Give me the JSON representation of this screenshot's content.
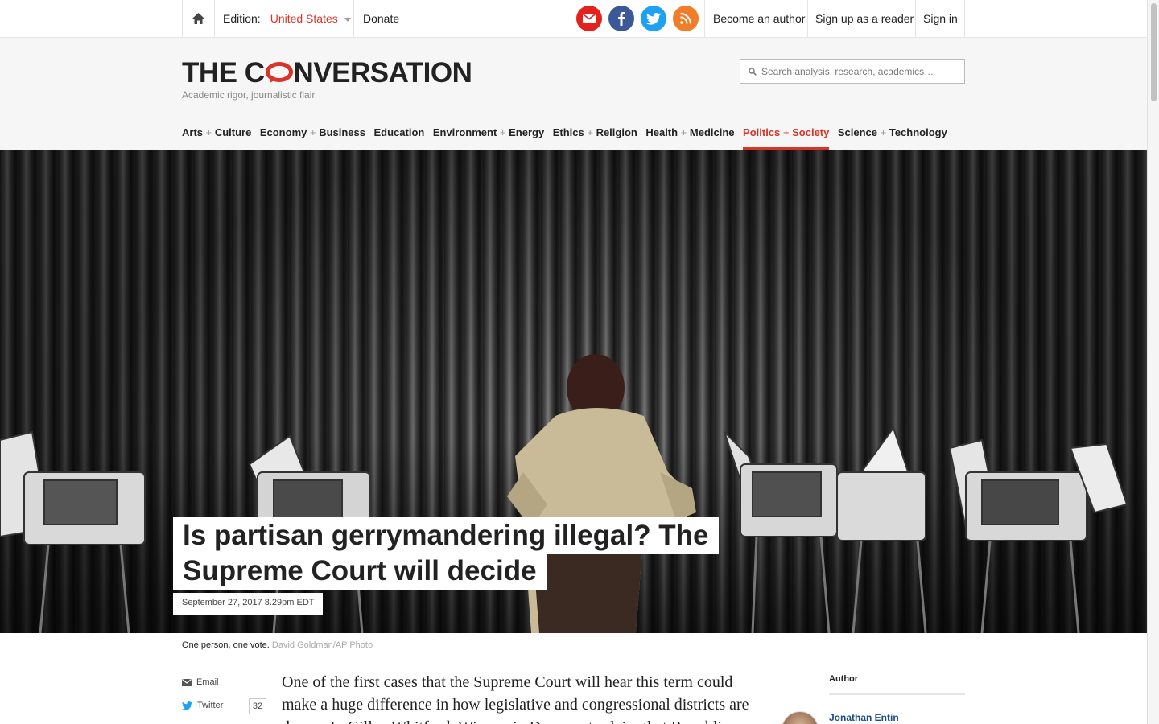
{
  "topbar": {
    "edition_label": "Edition:",
    "edition_value": "United States",
    "donate": "Donate",
    "become_author": "Become an author",
    "sign_up": "Sign up as a reader",
    "sign_in": "Sign in",
    "social": {
      "email_color": "#e3221e",
      "facebook_color": "#3b5998",
      "twitter_color": "#1da1f2",
      "rss_color": "#f07d28"
    }
  },
  "header": {
    "logo_pre": "THE C",
    "logo_post": "NVERSATION",
    "tagline": "Academic rigor, journalistic flair",
    "search_placeholder": "Search analysis, research, academics…"
  },
  "nav": [
    {
      "a": "Arts",
      "b": "Culture"
    },
    {
      "a": "Economy",
      "b": "Business"
    },
    {
      "a": "Education",
      "b": ""
    },
    {
      "a": "Environment",
      "b": "Energy"
    },
    {
      "a": "Ethics",
      "b": "Religion"
    },
    {
      "a": "Health",
      "b": "Medicine"
    },
    {
      "a": "Politics",
      "b": "Society"
    },
    {
      "a": "Science",
      "b": "Technology"
    }
  ],
  "nav_active_index": 6,
  "article": {
    "title_line1": "Is partisan gerrymandering illegal? The",
    "title_line2": "Supreme Court will decide",
    "date": "September 27, 2017 8.29pm EDT",
    "caption": "One person, one vote.",
    "caption_credit": "David Goldman/AP Photo",
    "body_line1": "One of the first cases that the Supreme Court will hear this term could",
    "body_line2": "make a huge difference in how legislative and congressional districts are",
    "body_line3": "drawn. In Gill v. Whitford, Wisconsin Democrats claim that Republicans"
  },
  "share": {
    "email": "Email",
    "twitter": "Twitter",
    "twitter_count": "32"
  },
  "sidebar": {
    "author_label": "Author",
    "author_name": "Jonathan Entin"
  },
  "colors": {
    "accent": "#d8352a",
    "link": "#1a4b82"
  }
}
